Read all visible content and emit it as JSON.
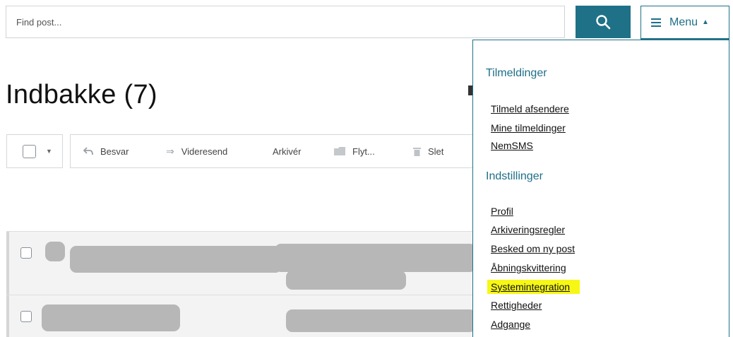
{
  "search": {
    "placeholder": "Find post..."
  },
  "menu": {
    "label": "Menu"
  },
  "page": {
    "title": "Indbakke (7)"
  },
  "toolbar": {
    "actions": [
      {
        "label": "Besvar",
        "icon": "reply-icon"
      },
      {
        "label": "Videresend",
        "icon": "forward-icon"
      },
      {
        "label": "Arkivér"
      },
      {
        "label": "Flyt...",
        "icon": "folder-icon"
      },
      {
        "label": "Slet",
        "icon": "trash-icon"
      }
    ]
  },
  "dropdown": {
    "sections": [
      {
        "title": "Tilmeldinger",
        "items": [
          "Tilmeld afsendere",
          "Mine tilmeldinger",
          "NemSMS"
        ]
      },
      {
        "title": "Indstillinger",
        "items": [
          "Profil",
          "Arkiveringsregler",
          "Besked om ny post",
          "Åbningskvittering",
          "Systemintegration",
          "Rettigheder",
          "Adgange"
        ]
      }
    ],
    "highlighted_item": "Systemintegration"
  },
  "colors": {
    "accent": "#1f7187",
    "highlight": "#f7f716",
    "redacted": "#b7b7b7"
  }
}
